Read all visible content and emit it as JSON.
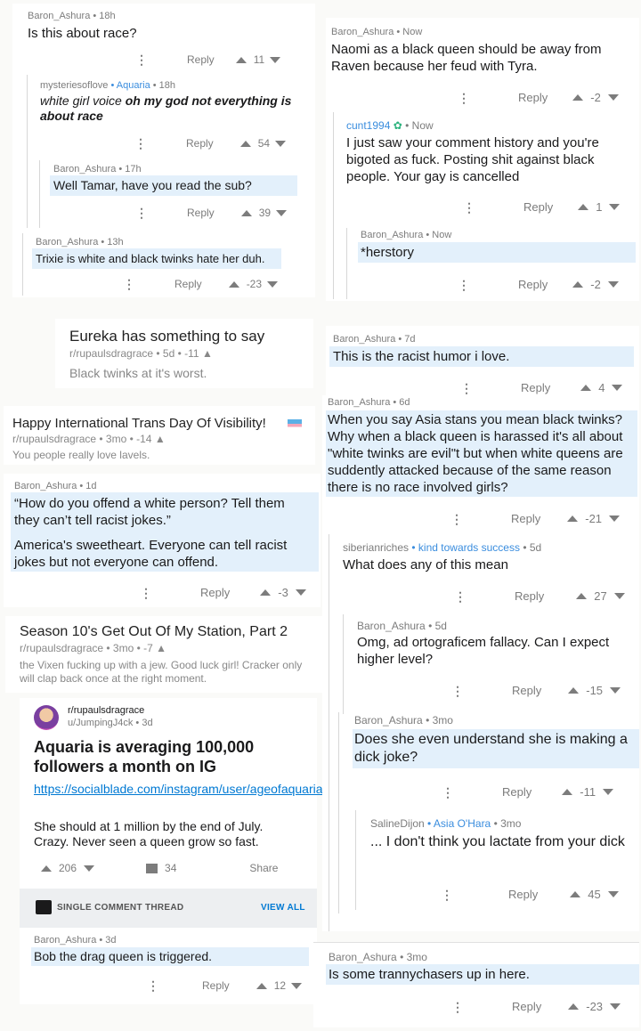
{
  "labels": {
    "reply": "Reply",
    "dots": "⋮",
    "share": "Share",
    "view_all": "VIEW ALL",
    "single_thread": "SINGLE COMMENT THREAD"
  },
  "left": {
    "c1": {
      "user": "Baron_Ashura",
      "time": "• 18h",
      "text": "Is this about race?",
      "score": "11"
    },
    "c2": {
      "user": "mysteriesoflove",
      "flair": "• Aquaria",
      "time": "• 18h",
      "text_italic": "white girl voice ",
      "text_bold": "oh my god not everything is about race",
      "score": "54"
    },
    "c3": {
      "user": "Baron_Ashura",
      "time": "• 17h",
      "text": "Well Tamar, have you read the sub?",
      "score": "39"
    },
    "c4": {
      "user": "Baron_Ashura",
      "time": "• 13h",
      "text": "Trixie is white and black twinks hate her duh.",
      "score": "-23"
    },
    "post1": {
      "title": "Eureka has something to say",
      "sub": "r/rupaulsdragrace • 5d • -11",
      "text": "Black twinks at it's worst."
    },
    "post2": {
      "title": "Happy International Trans Day Of Visibility!",
      "sub": "r/rupaulsdragrace • 3mo • -14",
      "text": "You people really love lavels."
    },
    "c5": {
      "user": "Baron_Ashura",
      "time": "• 1d",
      "quote": "“How do you offend a white person? Tell them they can’t tell racist jokes.”",
      "text": "America's sweetheart. Everyone can tell racist jokes but not everyone can offend.",
      "score": "-3"
    },
    "post3": {
      "title": "Season 10's Get Out Of My Station, Part 2",
      "sub": "r/rupaulsdragrace • 3mo • -7",
      "text": "the Vixen fucking up with a jew. Good luck girl! Cracker only will clap back once at the right moment."
    },
    "card": {
      "sub": "r/rupaulsdragrace",
      "user": "u/JumpingJ4ck • 3d",
      "title": "Aquaria is averaging 100,000 followers a month on IG",
      "link": "https://socialblade.com/instagram/user/ageofaquaria",
      "text": "She should at 1 million by the end of July. Crazy. Never seen a queen grow so fast.",
      "score": "206",
      "comments": "34"
    },
    "c6": {
      "user": "Baron_Ashura",
      "time": "• 3d",
      "text": "Bob the drag queen is triggered.",
      "score": "12"
    }
  },
  "right": {
    "r1": {
      "user": "Baron_Ashura",
      "time": "• Now",
      "text": "Naomi as a black queen should be away from Raven because her feud with Tyra.",
      "score": "-2"
    },
    "r2": {
      "user": "cunt1994",
      "time": "• Now",
      "text": "I just saw your comment history and you're bigoted as fuck. Posting shit against black people. Your gay is cancelled",
      "score": "1"
    },
    "r3": {
      "user": "Baron_Ashura",
      "time": "• Now",
      "text": "*herstory",
      "score": "-2"
    },
    "r4": {
      "user": "Baron_Ashura",
      "time": "• 7d",
      "text": "This is the racist humor i love.",
      "score": "4"
    },
    "r5": {
      "user": "Baron_Ashura",
      "time": "• 6d",
      "text": "When you say Asia stans you mean black twinks? Why when a black queen is harassed it's all about \"white twinks are evil\"t but when white queens are suddently attacked because of the same reason there is no race involved girls?",
      "score": "-21"
    },
    "r6": {
      "user": "siberianriches",
      "flair": "• kind towards success",
      "time": "• 5d",
      "text": "What does any of this mean",
      "score": "27"
    },
    "r7": {
      "user": "Baron_Ashura",
      "time": "• 5d",
      "text": "Omg, ad ortograficem fallacy. Can I expect higher level?",
      "score": "-15"
    },
    "r8": {
      "user": "Baron_Ashura",
      "time": "• 3mo",
      "text": "Does she even understand she is making a dick joke?",
      "score": "-11"
    },
    "r9": {
      "user": "SalineDijon",
      "flair": "• Asia O'Hara",
      "time": "• 3mo",
      "text": "... I don't think you lactate from your dick",
      "score": "45"
    },
    "r10": {
      "user": "Baron_Ashura",
      "time": "• 3mo",
      "text": "Is some trannychasers up in here.",
      "score": "-23"
    }
  },
  "colors": {
    "highlight": "#e3f0fb",
    "flair": "#3a8dde",
    "link": "#0079d3",
    "meta": "#7c7c7c"
  }
}
